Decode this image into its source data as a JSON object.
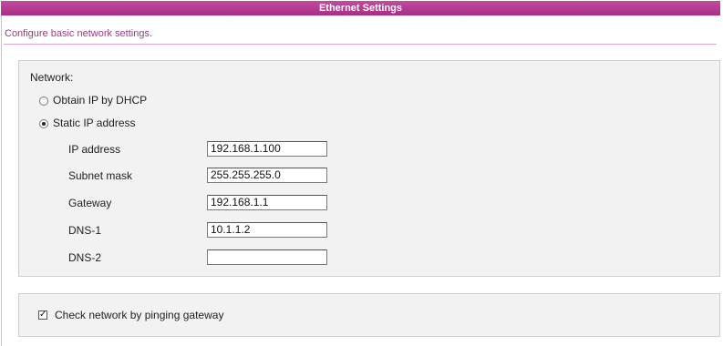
{
  "header": {
    "title": "Ethernet Settings"
  },
  "subtitle": "Configure basic network settings.",
  "network": {
    "heading": "Network:",
    "dhcp_label": "Obtain IP by DHCP",
    "static_label": "Static IP address",
    "selected": "static",
    "fields": [
      {
        "label": "IP address",
        "value": "192.168.1.100"
      },
      {
        "label": "Subnet mask",
        "value": "255.255.255.0"
      },
      {
        "label": "Gateway",
        "value": "192.168.1.1"
      },
      {
        "label": "DNS-1",
        "value": "10.1.1.2"
      },
      {
        "label": "DNS-2",
        "value": ""
      }
    ]
  },
  "ping": {
    "label": "Check network by pinging gateway",
    "checked": true
  }
}
